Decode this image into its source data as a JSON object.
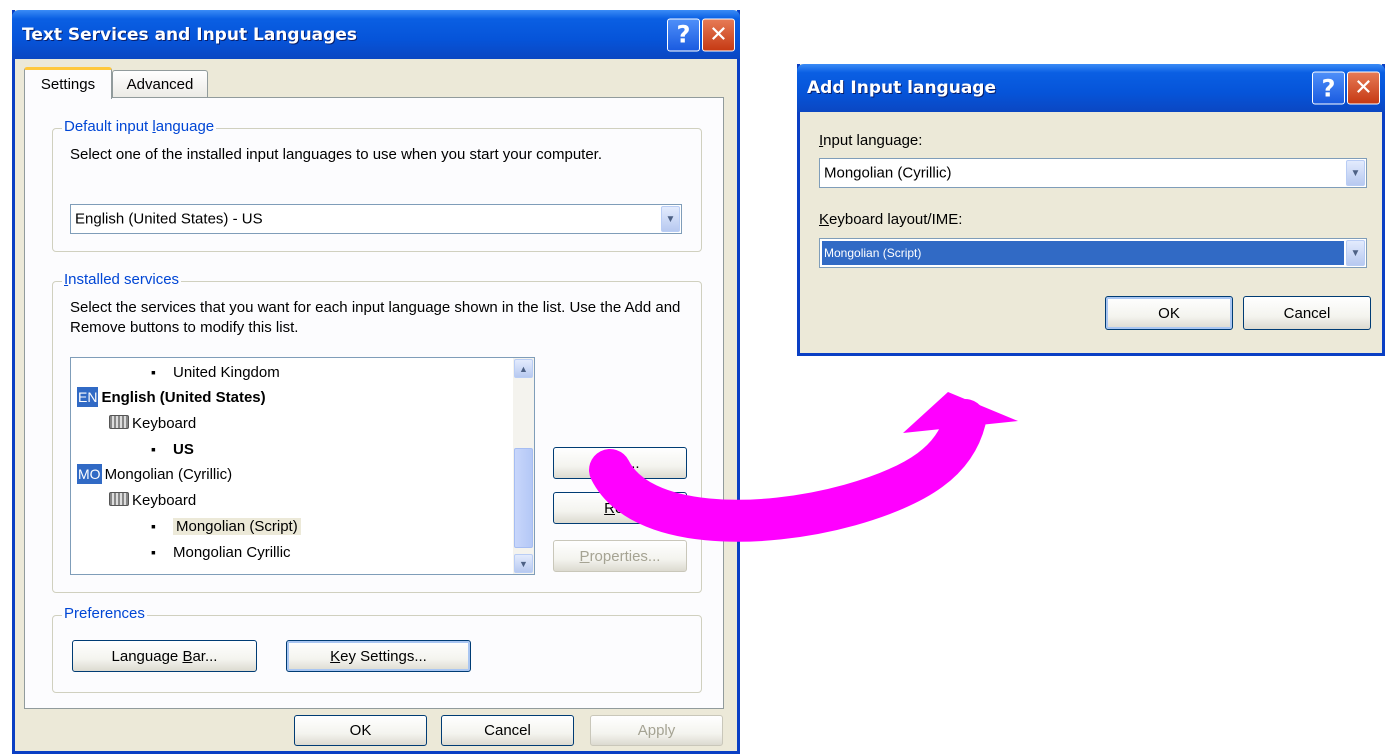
{
  "main_window": {
    "title": "Text Services and Input Languages",
    "help_glyph": "?",
    "close_glyph": "✕",
    "tabs": [
      {
        "label": "Settings"
      },
      {
        "label": "Advanced"
      }
    ],
    "default_group": {
      "legend_pre": "Default input ",
      "legend_key": "l",
      "legend_post": "anguage",
      "description": "Select one of the installed input languages to use when you start your computer.",
      "selected_value": "English (United States) - US"
    },
    "installed_group": {
      "legend_key": "I",
      "legend_post": "nstalled services",
      "description": "Select the services that you want for each input language shown in the list. Use the Add and Remove buttons to modify this list.",
      "tree": [
        {
          "text": "United Kingdom"
        },
        {
          "badge": "EN",
          "text": "English (United States)"
        },
        {
          "text": "Keyboard"
        },
        {
          "text": "US"
        },
        {
          "badge": "MO",
          "text": "Mongolian (Cyrillic)"
        },
        {
          "text": "Keyboard"
        },
        {
          "text": "Mongolian (Script)"
        },
        {
          "text": "Mongolian Cyrillic"
        }
      ],
      "bullet": "▪",
      "add_label": "Add...",
      "remove_key": "R",
      "remove_post": "em",
      "properties_key": "P",
      "properties_post": "roperties..."
    },
    "preferences_group": {
      "legend": "Preferences",
      "language_bar_pre": "Language ",
      "language_bar_key": "B",
      "language_bar_post": "ar...",
      "key_settings_key": "K",
      "key_settings_post": "ey Settings..."
    },
    "footer": {
      "ok": "OK",
      "cancel": "Cancel",
      "apply": "Apply"
    }
  },
  "add_dialog": {
    "title": "Add Input language",
    "help_glyph": "?",
    "close_glyph": "✕",
    "input_language_key": "I",
    "input_language_post": "nput language:",
    "input_language_value": "Mongolian (Cyrillic)",
    "keyboard_layout_key": "K",
    "keyboard_layout_post": "eyboard layout/IME:",
    "keyboard_layout_value": "Mongolian (Script)",
    "ok": "OK",
    "cancel": "Cancel"
  },
  "annotation": {
    "arrow_color": "#ff00ff"
  }
}
